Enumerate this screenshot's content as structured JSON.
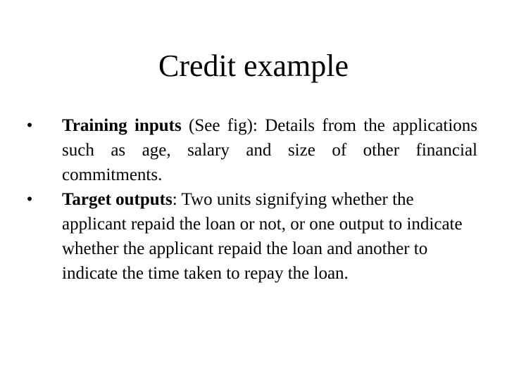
{
  "slide": {
    "title": "Credit example",
    "bullets": [
      {
        "marker": "•",
        "term": "Training inputs",
        "text": " (See fig): Details from the applications such as age, salary and size of other financial commitments."
      },
      {
        "marker": "•",
        "term": "Target outputs",
        "text": ": Two units signifying whether the applicant repaid the loan or not, or one output to indicate whether the applicant repaid the loan and another to indicate the time taken to repay the loan."
      }
    ]
  }
}
